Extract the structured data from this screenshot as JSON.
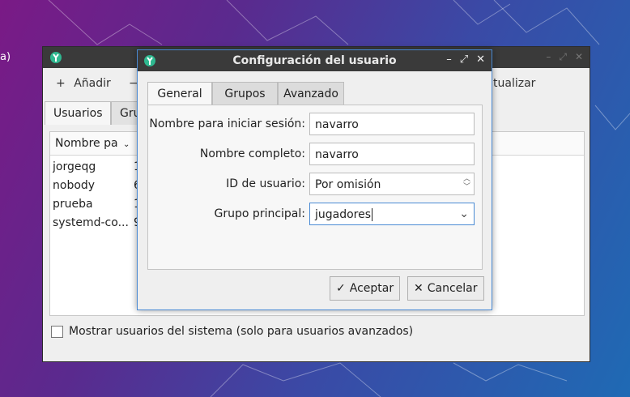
{
  "background_fragment": "a)",
  "main_window": {
    "toolbar": {
      "add_label": "Añadir",
      "remove_label": "−",
      "refresh_label": "tualizar"
    },
    "tabs": [
      "Usuarios",
      "Gru"
    ],
    "list": {
      "column_header": "Nombre pa",
      "rows": [
        {
          "name": "jorgeqg",
          "id": "1"
        },
        {
          "name": "nobody",
          "id": "6"
        },
        {
          "name": "prueba",
          "id": "1"
        },
        {
          "name": "systemd-co...",
          "id": "9"
        }
      ]
    },
    "show_system_users_label": "Mostrar usuarios del sistema (solo para usuarios avanzados)"
  },
  "dialog": {
    "title": "Configuración del usuario",
    "tabs": [
      "General",
      "Grupos",
      "Avanzado"
    ],
    "fields": {
      "login_label": "Nombre para iniciar sesión:",
      "login_value": "navarro",
      "fullname_label": "Nombre completo:",
      "fullname_value": "navarro",
      "uid_label": "ID de usuario:",
      "uid_value": "Por omisión",
      "group_label": "Grupo principal:",
      "group_value": "jugadores"
    },
    "buttons": {
      "accept": "Aceptar",
      "cancel": "Cancelar"
    }
  },
  "colors": {
    "accent": "#4a8ad4",
    "titlebar": "#3a3a3a",
    "window_bg": "#efefef",
    "app_icon": "#2fb890"
  }
}
